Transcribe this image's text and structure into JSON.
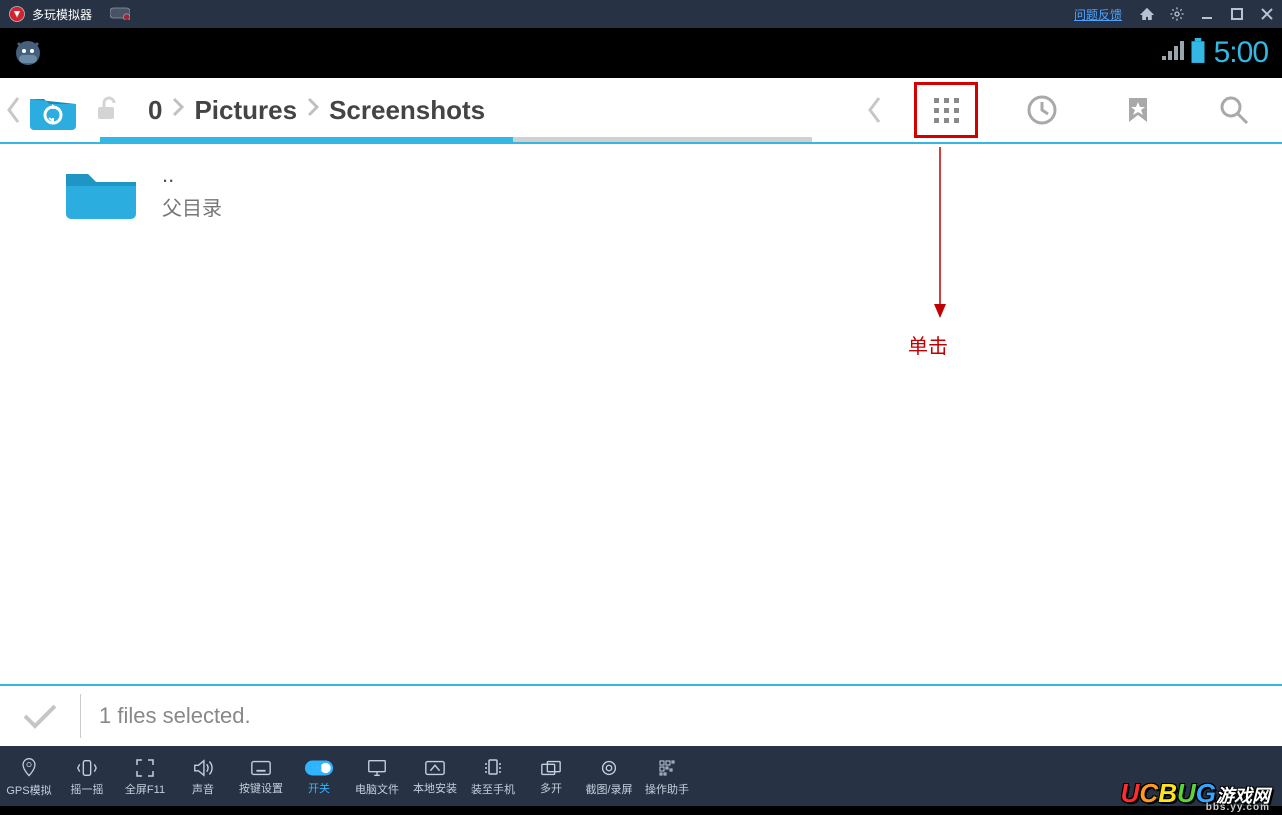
{
  "titlebar": {
    "app_name": "多玩模拟器",
    "feedback": "问题反馈"
  },
  "statusbar": {
    "clock": "5:00"
  },
  "breadcrumb": {
    "root": "0",
    "level1": "Pictures",
    "level2": "Screenshots"
  },
  "files": {
    "parent": {
      "name": "..",
      "sub": "父目录"
    }
  },
  "annotation": {
    "click_label": "单击"
  },
  "selection": {
    "text": "1 files selected."
  },
  "bottom": {
    "gps": "GPS模拟",
    "shake": "摇一摇",
    "fullscreen": "全屏F11",
    "sound": "声音",
    "keymap": "按键设置",
    "toggle": "开关",
    "pcfiles": "电脑文件",
    "localinstall": "本地安装",
    "tophone": "装至手机",
    "multi": "多开",
    "capture": "截图/录屏",
    "helper": "操作助手"
  },
  "watermark": {
    "text": "UCBUG",
    "sub": "bbs.yy.com"
  }
}
